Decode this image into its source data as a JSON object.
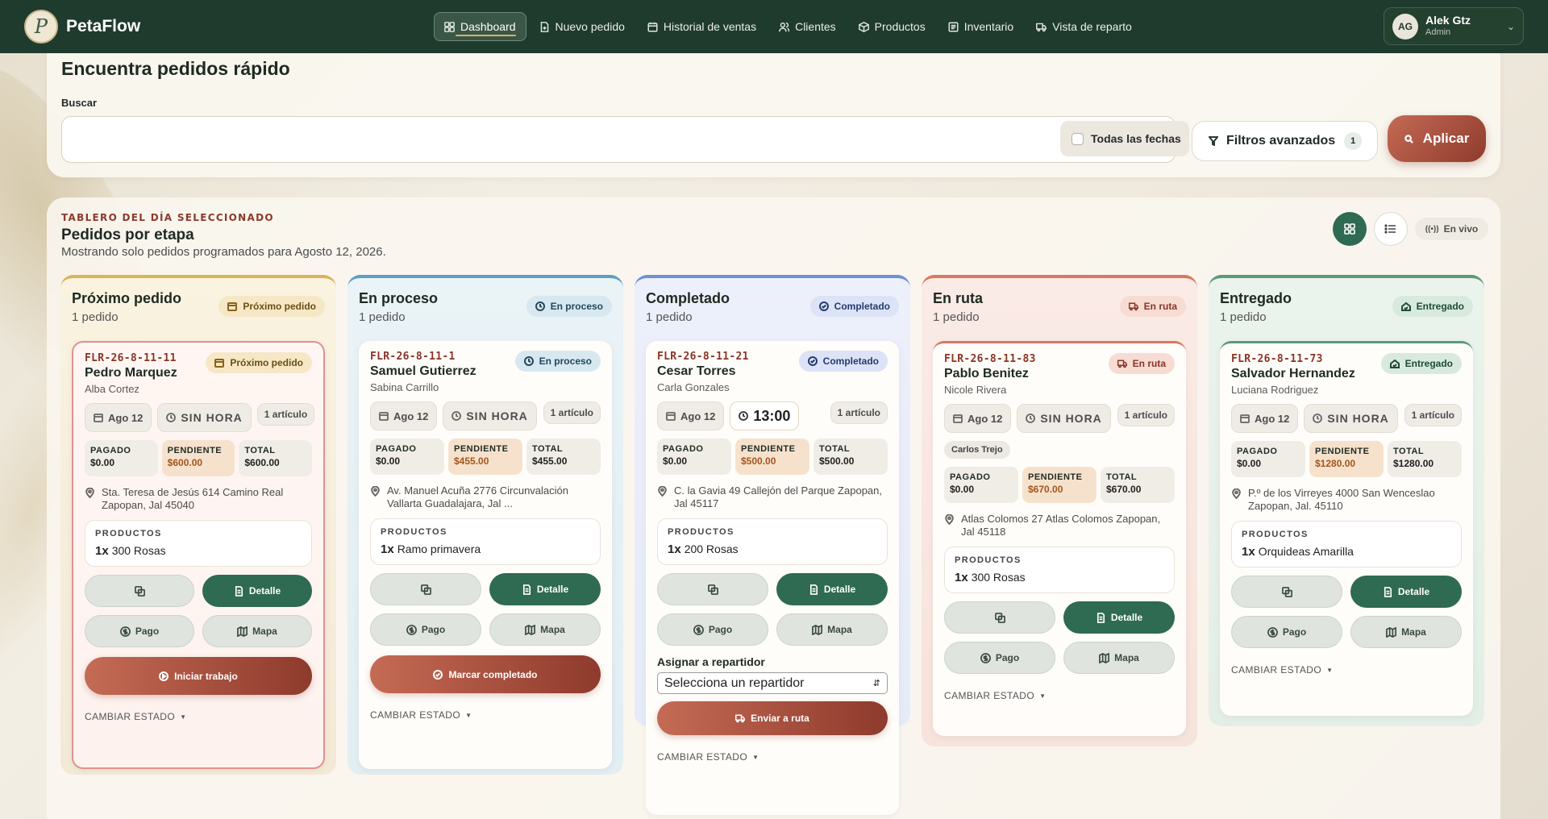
{
  "app": {
    "name": "PetaFlow"
  },
  "nav": [
    {
      "label": "Dashboard",
      "icon": "dashboard-icon",
      "active": true
    },
    {
      "label": "Nuevo pedido",
      "icon": "file-plus-icon"
    },
    {
      "label": "Historial de ventas",
      "icon": "calendar-icon"
    },
    {
      "label": "Clientes",
      "icon": "users-icon"
    },
    {
      "label": "Productos",
      "icon": "box-icon"
    },
    {
      "label": "Inventario",
      "icon": "list-icon"
    },
    {
      "label": "Vista de reparto",
      "icon": "truck-icon"
    }
  ],
  "user": {
    "initials": "AG",
    "name": "Alek Gtz",
    "role": "Admin"
  },
  "search": {
    "title": "Encuentra pedidos rápido",
    "label": "Buscar",
    "value": "",
    "all_dates_label": "Todas las fechas",
    "advanced_label": "Filtros avanzados",
    "advanced_count": "1",
    "apply_label": "Aplicar"
  },
  "board": {
    "kicker": "TABLERO DEL DÍA SELECCIONADO",
    "title": "Pedidos por etapa",
    "subtitle": "Mostrando solo pedidos programados para Agosto 12, 2026.",
    "live_label": "En vivo"
  },
  "columns": [
    {
      "title": "Próximo pedido",
      "count": "1 pedido",
      "badge": "Próximo pedido",
      "color": "#d9b45a",
      "card": {
        "id": "FLR-26-8-11-11",
        "name": "Pedro Marquez",
        "for": "Alba Cortez",
        "date": "Ago 12",
        "hour": "SIN HORA",
        "items": "1 artículo",
        "paid_label": "PAGADO",
        "paid": "$0.00",
        "pending_label": "PENDIENTE",
        "pending": "$600.00",
        "total_label": "TOTAL",
        "total": "$600.00",
        "address": "Sta. Teresa de Jesús 614 Camino Real Zapopan, Jal 45040",
        "products_label": "PRODUCTOS",
        "qty": "1x",
        "product": "300 Rosas",
        "detail": "Detalle",
        "pay": "Pago",
        "map": "Mapa",
        "action": "Iniciar trabajo",
        "change": "CAMBIAR ESTADO"
      }
    },
    {
      "title": "En proceso",
      "count": "1 pedido",
      "badge": "En proceso",
      "color": "#5aa0c4",
      "card": {
        "id": "FLR-26-8-11-1",
        "name": "Samuel Gutierrez",
        "for": "Sabina Carrillo",
        "date": "Ago 12",
        "hour": "SIN HORA",
        "items": "1 artículo",
        "paid_label": "PAGADO",
        "paid": "$0.00",
        "pending_label": "PENDIENTE",
        "pending": "$455.00",
        "total_label": "TOTAL",
        "total": "$455.00",
        "address": "Av. Manuel Acuña 2776 Circunvalación Vallarta Guadalajara, Jal ...",
        "products_label": "PRODUCTOS",
        "qty": "1x",
        "product": "Ramo primavera",
        "detail": "Detalle",
        "pay": "Pago",
        "map": "Mapa",
        "action": "Marcar completado",
        "change": "CAMBIAR ESTADO"
      }
    },
    {
      "title": "Completado",
      "count": "1 pedido",
      "badge": "Completado",
      "color": "#6f8fd8",
      "card": {
        "id": "FLR-26-8-11-21",
        "name": "Cesar Torres",
        "for": "Carla Gonzales",
        "date": "Ago 12",
        "hour": "13:00",
        "items": "1 artículo",
        "paid_label": "PAGADO",
        "paid": "$0.00",
        "pending_label": "PENDIENTE",
        "pending": "$500.00",
        "total_label": "TOTAL",
        "total": "$500.00",
        "address": "C. la Gavia 49 Callejón del Parque Zapopan, Jal 45117",
        "products_label": "PRODUCTOS",
        "qty": "1x",
        "product": "200 Rosas",
        "detail": "Detalle",
        "pay": "Pago",
        "map": "Mapa",
        "assign_label": "Asignar a repartidor",
        "assign_placeholder": "Selecciona un repartidor",
        "action": "Enviar a ruta",
        "change": "CAMBIAR ESTADO"
      }
    },
    {
      "title": "En ruta",
      "count": "1 pedido",
      "badge": "En ruta",
      "color": "#d77a62",
      "card": {
        "id": "FLR-26-8-11-83",
        "name": "Pablo Benitez",
        "for": "Nicole Rivera",
        "date": "Ago 12",
        "hour": "SIN HORA",
        "items": "1 artículo",
        "driver": "Carlos Trejo",
        "paid_label": "PAGADO",
        "paid": "$0.00",
        "pending_label": "PENDIENTE",
        "pending": "$670.00",
        "total_label": "TOTAL",
        "total": "$670.00",
        "address": "Atlas Colomos 27 Atlas Colomos Zapopan, Jal 45118",
        "products_label": "PRODUCTOS",
        "qty": "1x",
        "product": "300 Rosas",
        "detail": "Detalle",
        "pay": "Pago",
        "map": "Mapa",
        "change": "CAMBIAR ESTADO"
      }
    },
    {
      "title": "Entregado",
      "count": "1 pedido",
      "badge": "Entregado",
      "color": "#5c9a78",
      "card": {
        "id": "FLR-26-8-11-73",
        "name": "Salvador Hernandez",
        "for": "Luciana Rodriguez",
        "date": "Ago 12",
        "hour": "SIN HORA",
        "items": "1 artículo",
        "paid_label": "PAGADO",
        "paid": "$0.00",
        "pending_label": "PENDIENTE",
        "pending": "$1280.00",
        "total_label": "TOTAL",
        "total": "$1280.00",
        "address": "P.º de los Virreyes 4000 San Wenceslao Zapopan, Jal. 45110",
        "products_label": "PRODUCTOS",
        "qty": "1x",
        "product": "Orquideas Amarilla",
        "detail": "Detalle",
        "pay": "Pago",
        "map": "Mapa",
        "change": "CAMBIAR ESTADO"
      }
    }
  ]
}
